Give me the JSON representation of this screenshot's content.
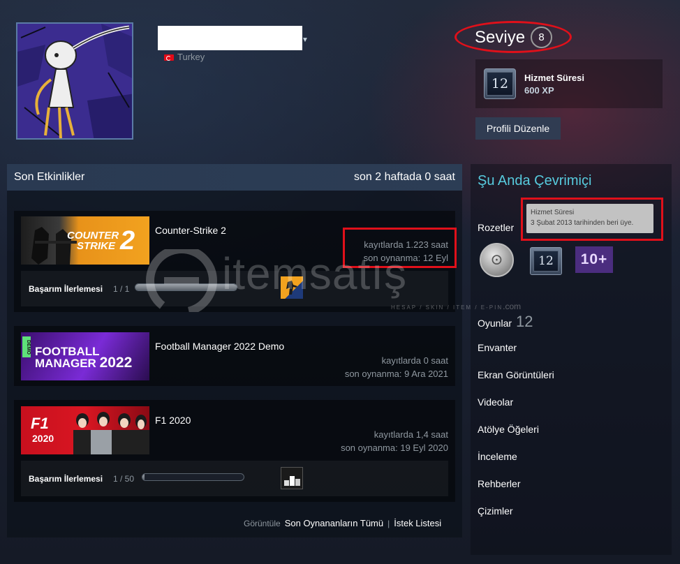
{
  "profile": {
    "country": "Turkey",
    "level_label": "Seviye",
    "level": "8",
    "badge": {
      "icon_text": "12",
      "title": "Hizmet Süresi",
      "xp": "600 XP"
    },
    "edit_button": "Profili Düzenle"
  },
  "activity": {
    "header_title": "Son Etkinlikler",
    "header_hours": "son 2 haftada 0 saat",
    "achievement_label": "Başarım İlerlemesi",
    "games": [
      {
        "title": "Counter-Strike 2",
        "capsule_text_1": "COUNTER",
        "capsule_text_2": "STRIKE",
        "capsule_num": "2",
        "hours": "kayıtlarda 1.223 saat",
        "last_played": "son oynanma: 12 Eyl",
        "achievement_count": "1 / 1",
        "achievement_progress": 1.0
      },
      {
        "title": "Football Manager 2022 Demo",
        "capsule_text_1": "FOOTBALL",
        "capsule_text_2": "MANAGER",
        "capsule_num": "2022",
        "capsule_demo": "DEMO",
        "hours": "kayıtlarda 0 saat",
        "last_played": "son oynanma: 9 Ara 2021"
      },
      {
        "title": "F1 2020",
        "capsule_text_1": "F1",
        "capsule_text_2": "2020",
        "hours": "kayıtlarda 1,4 saat",
        "last_played": "son oynanma: 19 Eyl 2020",
        "achievement_count": "1 / 50",
        "achievement_progress": 0.02
      }
    ],
    "footer": {
      "view": "Görüntüle",
      "recent_all": "Son Oynananların Tümü",
      "separator": "|",
      "wishlist": "İstek Listesi"
    }
  },
  "sidebar": {
    "status": "Şu Anda Çevrimiçi",
    "badges_label": "Rozetler",
    "tooltip_title": "Hizmet Süresi",
    "tooltip_body": "3 Şubat 2013 tarihinden beri üye.",
    "badge_years": "12",
    "badge_games": "10+",
    "games_label": "Oyunlar",
    "games_count": "12",
    "links": [
      "Envanter",
      "Ekran Görüntüleri",
      "Videolar",
      "Atölye Öğeleri",
      "İnceleme",
      "Rehberler",
      "Çizimler"
    ]
  },
  "watermark": {
    "text": "itemsatış",
    "sub": "HESAP / SKIN / ITEM / E-PIN",
    "dotcom": ".com"
  },
  "colors": {
    "accent_online": "#57cbde",
    "highlight_red": "#e0101a",
    "panel_header": "#2a3a52"
  }
}
